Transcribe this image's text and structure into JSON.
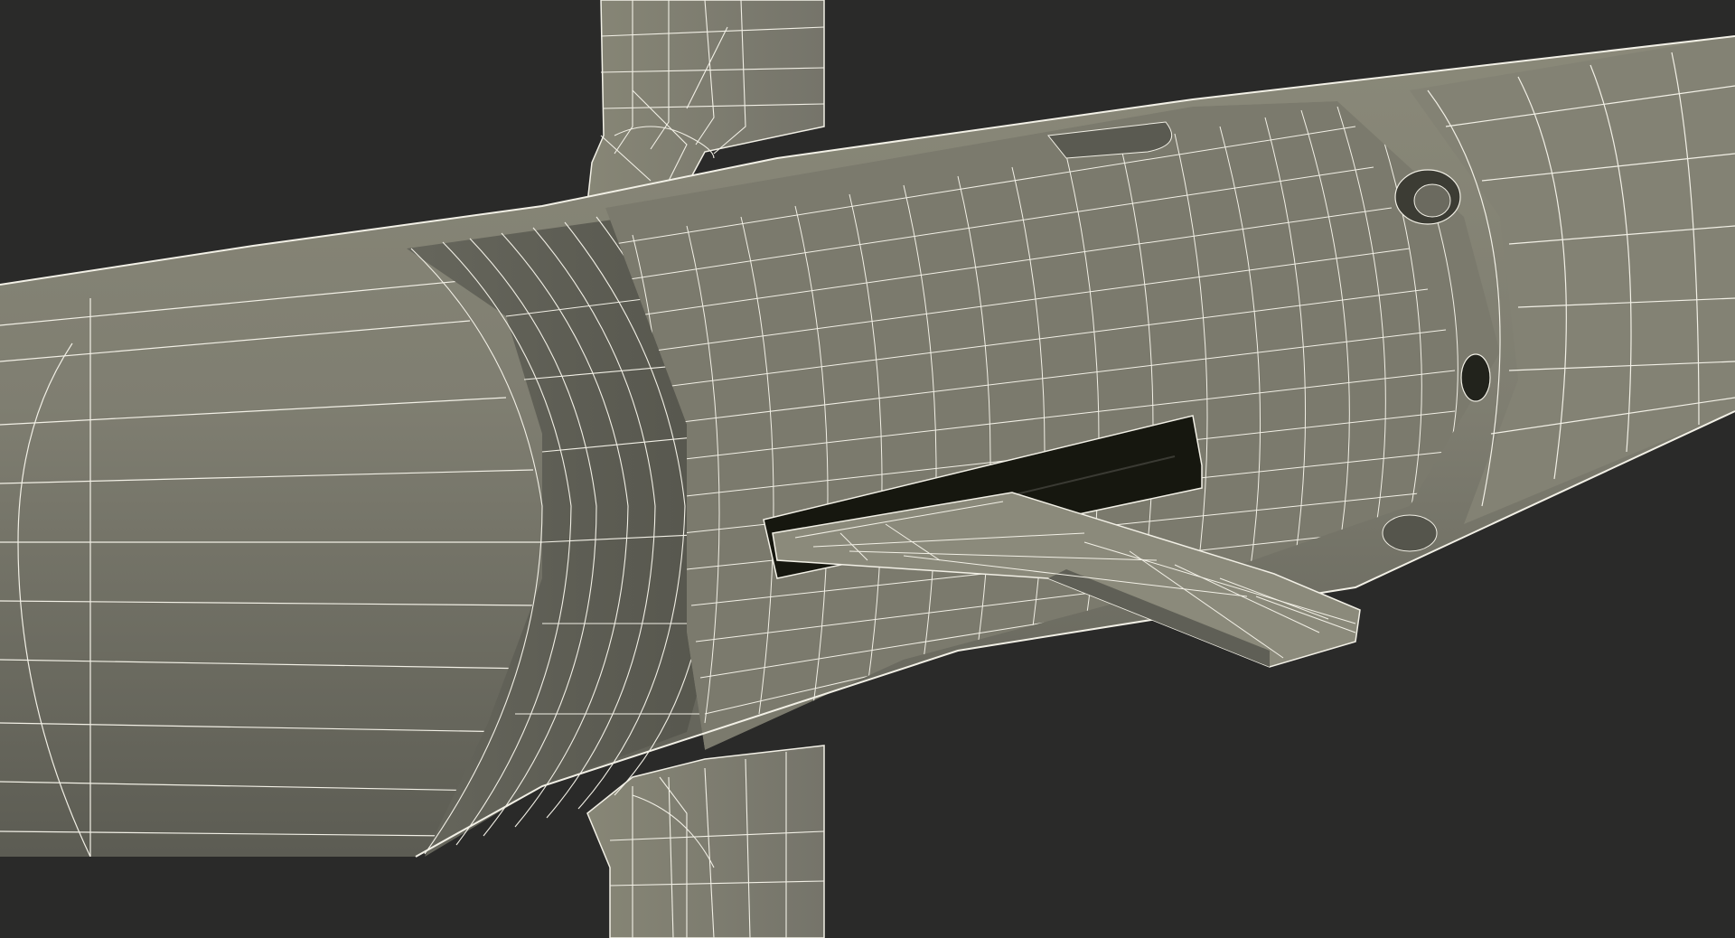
{
  "scene": {
    "subject": "missile-body-wireframe",
    "render_style": "wireframe-over-shaded",
    "background_color": "#2a2a29",
    "surface_color": "#807f72",
    "surface_dark_color": "#4f4f46",
    "wire_color": "#f2f0e6",
    "cavity_color": "#16170f"
  }
}
